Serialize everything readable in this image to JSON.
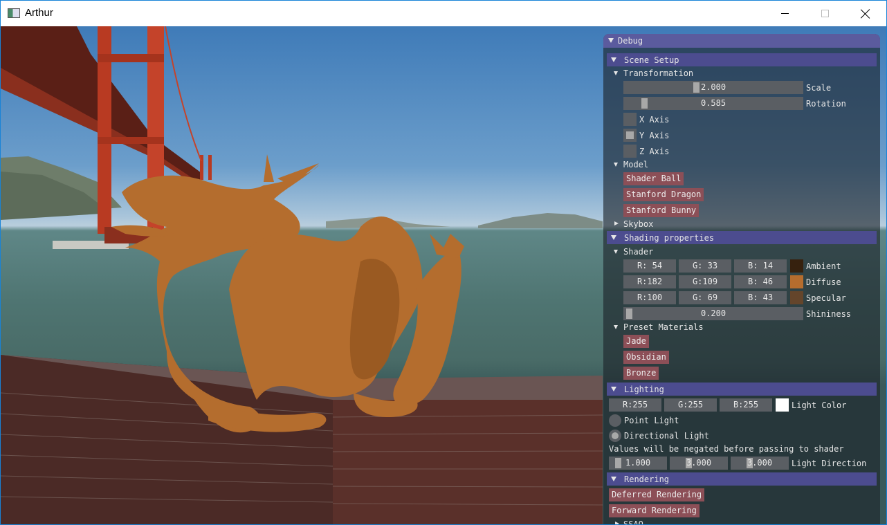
{
  "window": {
    "title": "Arthur"
  },
  "debug": {
    "title": "Debug",
    "scene_setup": {
      "header": "Scene Setup",
      "transformation": {
        "label": "Transformation",
        "scale": {
          "value": "2.000",
          "label": "Scale",
          "fraction": 0.4
        },
        "rotation": {
          "value": "0.585",
          "label": "Rotation",
          "fraction": 0.09
        },
        "x_axis": {
          "label": "X Axis",
          "checked": false
        },
        "y_axis": {
          "label": "Y Axis",
          "checked": true
        },
        "z_axis": {
          "label": "Z Axis",
          "checked": false
        }
      },
      "model": {
        "label": "Model",
        "buttons": [
          "Shader Ball",
          "Stanford Dragon",
          "Stanford Bunny"
        ]
      },
      "skybox": {
        "label": "Skybox"
      }
    },
    "shading": {
      "header": "Shading properties",
      "shader": {
        "label": "Shader",
        "ambient": {
          "r": "R: 54",
          "g": "G: 33",
          "b": "B: 14",
          "color": "#36210e",
          "label": "Ambient"
        },
        "diffuse": {
          "r": "R:182",
          "g": "G:109",
          "b": "B: 46",
          "color": "#b66d2e",
          "label": "Diffuse"
        },
        "specular": {
          "r": "R:100",
          "g": "G: 69",
          "b": "B: 43",
          "color": "#64452b",
          "label": "Specular"
        },
        "shininess": {
          "value": "0.200",
          "label": "Shininess",
          "fraction": 0.02
        }
      },
      "presets": {
        "label": "Preset Materials",
        "buttons": [
          "Jade",
          "Obsidian",
          "Bronze"
        ]
      }
    },
    "lighting": {
      "header": "Lighting",
      "color": {
        "r": "R:255",
        "g": "G:255",
        "b": "B:255",
        "swatch": "#ffffff",
        "label": "Light Color"
      },
      "point_light": {
        "label": "Point Light",
        "selected": false
      },
      "directional_light": {
        "label": "Directional Light",
        "selected": true
      },
      "note": "Values will be negated before passing to shader",
      "direction": {
        "x": "1.000",
        "y": "3.000",
        "z": "3.000",
        "label": "Light Direction"
      }
    },
    "rendering": {
      "header": "Rendering",
      "buttons": [
        "Deferred Rendering",
        "Forward Rendering"
      ],
      "ssao": {
        "label": "SSAO"
      }
    }
  },
  "colors": {
    "panel_title": "#5b5b9e",
    "header": "#4c4c8f",
    "button": "#8c4f57",
    "widget": "#5a5e63",
    "dragon": "#b46d2e"
  }
}
